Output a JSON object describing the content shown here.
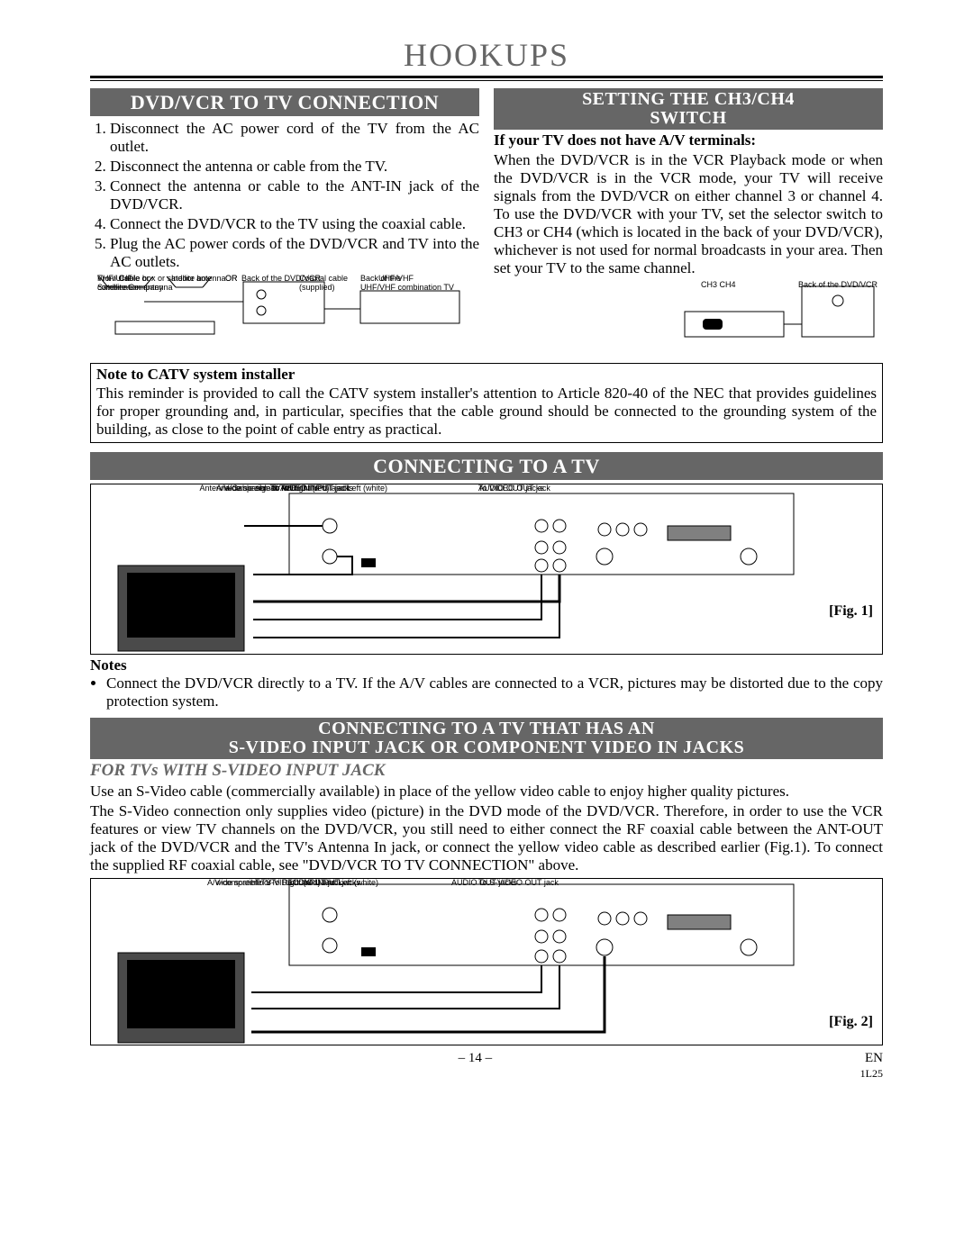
{
  "page_title": "HOOKUPS",
  "sections": {
    "dvd_tv": {
      "bar": "DVD/VCR TO TV CONNECTION",
      "steps": [
        "Disconnect the AC power cord of the TV from the AC outlet.",
        "Disconnect the antenna or cable from the TV.",
        "Connect the antenna or cable to the ANT-IN jack of the DVD/VCR.",
        "Connect the DVD/VCR to the TV using the coaxial cable.",
        "Plug the AC power cords of the DVD/VCR and TV into the AC outlets."
      ],
      "diagram": {
        "labels": {
          "l1": "VHF/UHF\ncombination antenna",
          "l2": "Indoor antenna",
          "l3": "Back of the DVD/VCR",
          "l4": "Back of the\nUHF/VHF combination TV",
          "l5": "Coaxial cable\n(supplied)",
          "l6": "Cable box or satellite box",
          "l7": "From Cable or\nSatellite Company",
          "or1": "OR",
          "or2": "OR",
          "uhfvhf": "UHF/VHF"
        }
      }
    },
    "ch3ch4": {
      "bar_line1": "SETTING THE CH3/CH4",
      "bar_line2": "SWITCH",
      "lead_bold": "If your TV does not have A/V terminals:",
      "body": "When the DVD/VCR is in the VCR Playback mode or when the DVD/VCR is in the VCR mode, your TV will receive signals from the DVD/VCR on either channel 3 or channel 4. To use the DVD/VCR with your TV, set the selector switch to CH3 or CH4 (which is located in the back of your DVD/VCR), whichever is not used for normal broadcasts in your area. Then set your TV to the same channel.",
      "diagram_label_back": "Back of the DVD/VCR",
      "diagram_switch": "CH3  CH4"
    },
    "catv_note": {
      "title": "Note to CATV system installer",
      "body": "This reminder is provided to call the CATV system installer's attention to Article 820-40 of the NEC that provides guidelines for proper grounding and, in particular, specifies that the cable ground should be connected to the grounding system of the building, as close to the point of cable entry as practical."
    },
    "connect_tv": {
      "bar": "CONNECTING TO A TV",
      "fig": "[Fig. 1]",
      "diagram": {
        "labels": {
          "l_ant_sig": "Antenna/Cable signal",
          "l_av_tv1": "A/V-compatible or",
          "l_av_tv2": "wide screen TV",
          "l_to_ant1": "To ANT. IN",
          "l_to_ant2": "of TV",
          "l_vid_in": "To VIDEO INPUT jack",
          "l_vid_out": "To VIDEO OUT jack",
          "l_audio_lr": "To Right (red) and Left (white)",
          "l_audio_in": "AUDIO INPUT jacks",
          "l_audio_out": "AUDIO OUT jacks"
        }
      },
      "notes_heading": "Notes",
      "notes_bullet": "Connect the DVD/VCR directly to a TV. If the A/V cables are connected to a VCR, pictures may be distorted due to the copy protection system."
    },
    "svideo": {
      "bar_line1": "CONNECTING TO A TV THAT HAS AN",
      "bar_line2": "S-VIDEO INPUT JACK OR COMPONENT VIDEO IN JACKS",
      "subhead": "FOR TVs WITH S-VIDEO INPUT JACK",
      "para1": "Use an S-Video cable (commercially available) in place of the yellow video cable to enjoy higher quality pictures.",
      "para2": "The S-Video connection only supplies video (picture) in the DVD mode of the DVD/VCR. Therefore, in order to use the VCR features or view TV channels on the DVD/VCR, you still need to either connect the RF coaxial cable between the ANT-OUT jack of the DVD/VCR and the TV's Antenna In jack, or connect the yellow video cable as described earlier (Fig.1). To connect the supplied RF coaxial cable, see \"DVD/VCR TO TV CONNECTION\" above.",
      "fig": "[Fig. 2]",
      "diagram": {
        "labels": {
          "l_av_tv1": "A/V-compatible or",
          "l_av_tv2": "wide screen TV",
          "l_audio_lr": "To Right (red) and Left (white)",
          "l_audio_in": "AUDIO INPUT jacks",
          "l_audio_out": "AUDIO OUT jacks",
          "l_svid_in": "To S-VIDEO INPUT jack",
          "l_svid_out": "To S-VIDEO OUT jack"
        }
      }
    }
  },
  "footer": {
    "page_num": "– 14 –",
    "en": "EN",
    "code": "1L25"
  }
}
